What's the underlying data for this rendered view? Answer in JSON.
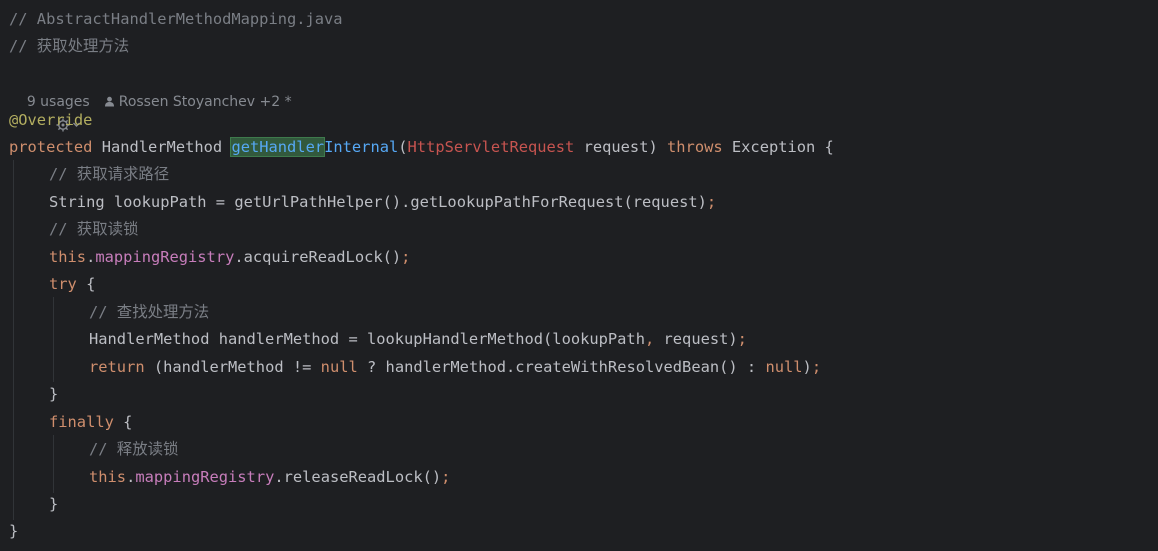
{
  "file_comment": "// AbstractHandlerMethodMapping.java",
  "title_comment": "// 获取处理方法",
  "inlay": {
    "usages": "9 usages",
    "author": "Rossen Stoyanchev +2 *"
  },
  "code": {
    "annotation": "@Override",
    "sig_protected": "protected",
    "sig_type": "HandlerMethod",
    "sig_name_hl": "getHandler",
    "sig_name_rest": "Internal",
    "sig_paren_open": "(",
    "sig_param_type": "HttpServletRequest",
    "sig_param_rest": " request)",
    "sig_throws": "throws",
    "sig_exception": " Exception {",
    "c1": "// 获取请求路径",
    "l1": "String lookupPath = getUrlPathHelper().getLookupPathForRequest(request)",
    "l1_semi": ";",
    "c2": "// 获取读锁",
    "l2_this": "this",
    "l2_dot": ".",
    "l2_field": "mappingRegistry",
    "l2_rest": ".acquireReadLock()",
    "l2_semi": ";",
    "try": "try",
    "try_brace": " {",
    "c3": "// 查找处理方法",
    "l3_a": "HandlerMethod handlerMethod = lookupHandlerMethod(lookupPath",
    "l3_comma": ",",
    "l3_b": " request)",
    "l3_semi": ";",
    "ret_kw": "return",
    "ret_a": " (handlerMethod != ",
    "ret_null1": "null",
    "ret_b": " ? handlerMethod.createWithResolvedBean() : ",
    "ret_null2": "null",
    "ret_c": ")",
    "ret_semi": ";",
    "close_try": "}",
    "finally": "finally",
    "finally_brace": " {",
    "c4": "// 释放读锁",
    "l4_this": "this",
    "l4_dot": ".",
    "l4_field": "mappingRegistry",
    "l4_rest": ".releaseReadLock()",
    "l4_semi": ";",
    "close_finally": "}",
    "close_method": "}"
  }
}
